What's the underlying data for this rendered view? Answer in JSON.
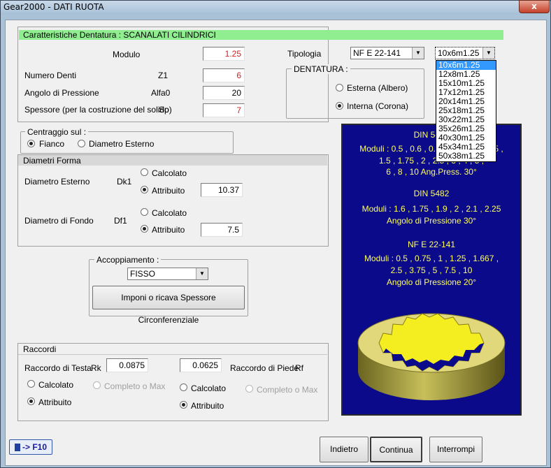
{
  "window": {
    "title": "Gear2000 - DATI RUOTA",
    "close": "x"
  },
  "header": {
    "title": "Caratteristiche Dentatura : SCANALATI CILINDRICI"
  },
  "fields": {
    "modulo": {
      "label": "Modulo",
      "value": "1.25"
    },
    "numero_denti": {
      "label": "Numero Denti",
      "symbol": "Z1",
      "value": "6"
    },
    "angolo": {
      "label": "Angolo di Pressione",
      "symbol": "Alfa0",
      "value": "20"
    },
    "spessore": {
      "label": "Spessore (per la costruzione del solido)",
      "symbol": "Sp",
      "value": "7"
    }
  },
  "tipologia": {
    "label": "Tipologia",
    "value": "NF E 22-141",
    "size_value": "10x6m1.25"
  },
  "size_options": [
    "10x6m1.25",
    "12x8m1.25",
    "15x10m1.25",
    "17x12m1.25",
    "20x14m1.25",
    "25x18m1.25",
    "30x22m1.25",
    "35x26m1.25",
    "40x30m1.25",
    "45x34m1.25",
    "50x38m1.25"
  ],
  "dentatura": {
    "label": "DENTATURA :",
    "esterna": "Esterna (Albero)",
    "interna": "Interna (Corona)"
  },
  "centraggio": {
    "label": "Centraggio sul :",
    "fianco": "Fianco",
    "diametro": "Diametro Esterno"
  },
  "diametri": {
    "title": "Diametri Forma",
    "esterno": {
      "label": "Diametro Esterno",
      "symbol": "Dk1",
      "calcolato": "Calcolato",
      "attribuito": "Attribuito",
      "value": "10.37"
    },
    "fondo": {
      "label": "Diametro di Fondo",
      "symbol": "Df1",
      "calcolato": "Calcolato",
      "attribuito": "Attribuito",
      "value": "7.5"
    }
  },
  "accoppiamento": {
    "label": "Accoppiamento :",
    "value": "FISSO",
    "button": "Imponi o ricava Spessore Circonferenziale"
  },
  "raccordi": {
    "title": "Raccordi",
    "testa": {
      "label": "Raccordo di Testa",
      "symbol": "Rk",
      "value": "0.0875",
      "calcolato": "Calcolato",
      "completo": "Completo o Max",
      "attribuito": "Attribuito"
    },
    "piede": {
      "label": "Raccordo di Piede",
      "symbol": "Rf",
      "value": "0.0625",
      "calcolato": "Calcolato",
      "completo": "Completo o Max",
      "attribuito": "Attribuito"
    }
  },
  "info": {
    "din5480_title": "DIN 5480",
    "din5480_l1": "Moduli : 0.5 , 0.6 , 0.75 , 0.8 , 1 , 1.25 ,",
    "din5480_l2": "1.5 , 1.75 , 2 , 2.5 , 3 , 4 , 5 ,",
    "din5480_l3": "6 , 8 , 10     Ang.Press. 30°",
    "din5482_title": "DIN 5482",
    "din5482_l1": "Moduli : 1.6 , 1.75 , 1.9 , 2 , 2.1 , 2.25",
    "din5482_l2": "Angolo di Pressione 30°",
    "nfe_title": "NF E 22-141",
    "nfe_l1": "Moduli : 0.5 , 0.75 , 1 , 1.25 , 1.667 ,",
    "nfe_l2": "2.5 , 3.75 , 5 , 7.5 , 10",
    "nfe_l3": "Angolo di Pressione 20°"
  },
  "footer": {
    "f10": "-> F10",
    "indietro": "Indietro",
    "continua": "Continua",
    "interrompi": "Interrompi"
  },
  "colors": {
    "header_bg": "#90ee90",
    "info_bg": "#0a0a8a",
    "info_text": "#ffff60",
    "red_value": "#d02020",
    "selection": "#3399ff"
  }
}
